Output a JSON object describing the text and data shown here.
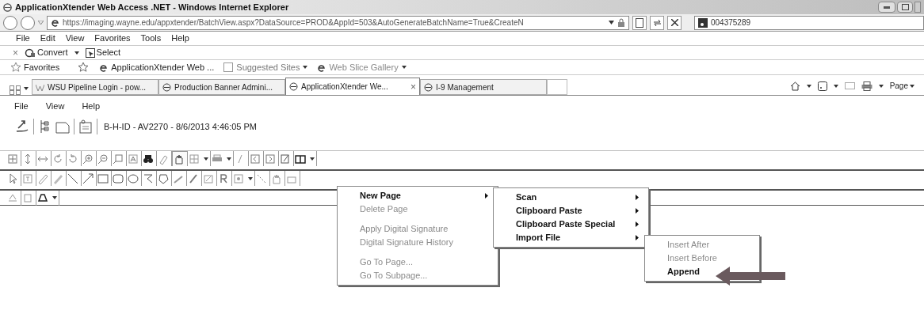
{
  "window": {
    "title": "ApplicationXtender Web Access .NET - Windows Internet Explorer"
  },
  "address_bar": {
    "url": "https://imaging.wayne.edu/appxtender/BatchView.aspx?DataSource=PROD&AppId=503&AutoGenerateBatchName=True&CreateN",
    "search_value": "004375289"
  },
  "menu_bar": [
    "File",
    "Edit",
    "View",
    "Favorites",
    "Tools",
    "Help"
  ],
  "command_bar": [
    {
      "kind": "close",
      "label": "×"
    },
    {
      "kind": "convert",
      "label": "Convert"
    },
    {
      "kind": "select",
      "label": "Select"
    }
  ],
  "favorites_bar": [
    {
      "kind": "favorites",
      "label": "Favorites"
    },
    {
      "kind": "page",
      "label": "ApplicationXtender Web ..."
    },
    {
      "kind": "suggested",
      "label": "Suggested Sites"
    },
    {
      "kind": "slice",
      "label": "Web Slice Gallery"
    }
  ],
  "tabs": [
    {
      "label": "WSU Pipeline Login - pow...",
      "selected": false
    },
    {
      "label": "Production Banner Admini...",
      "selected": false
    },
    {
      "label": "ApplicationXtender We...",
      "selected": true,
      "close": "×"
    },
    {
      "label": "I-9 Management",
      "selected": false
    }
  ],
  "ie_tools": {
    "page_menu": "Page"
  },
  "app_menu": [
    "File",
    "View",
    "Help"
  ],
  "batch_label": "B-H-ID - AV2270 - 8/6/2013 4:46:05 PM",
  "context_menu": [
    {
      "kind": "item",
      "label": "New Page",
      "disabled": false,
      "submenu": true
    },
    {
      "kind": "item",
      "label": "Delete Page",
      "disabled": true,
      "submenu": false
    },
    {
      "kind": "separator"
    },
    {
      "kind": "item",
      "label": "Apply Digital Signature",
      "disabled": true,
      "submenu": false
    },
    {
      "kind": "item",
      "label": "Digital Signature History",
      "disabled": true,
      "submenu": false
    },
    {
      "kind": "separator"
    },
    {
      "kind": "item",
      "label": "Go To Page...",
      "disabled": true,
      "submenu": false
    },
    {
      "kind": "item",
      "label": "Go To Subpage...",
      "disabled": true,
      "submenu": false
    }
  ],
  "submenu": [
    {
      "kind": "item",
      "label": "Scan",
      "disabled": false,
      "submenu": true
    },
    {
      "kind": "item",
      "label": "Clipboard Paste",
      "disabled": false,
      "submenu": true
    },
    {
      "kind": "item",
      "label": "Clipboard Paste Special",
      "disabled": false,
      "submenu": true
    },
    {
      "kind": "item",
      "label": "Import File",
      "disabled": false,
      "submenu": true
    }
  ],
  "import_submenu": [
    {
      "kind": "item",
      "label": "Insert After",
      "disabled": true,
      "submenu": false
    },
    {
      "kind": "item",
      "label": "Insert Before",
      "disabled": true,
      "submenu": false
    },
    {
      "kind": "item",
      "label": "Append",
      "disabled": false,
      "submenu": false
    }
  ]
}
